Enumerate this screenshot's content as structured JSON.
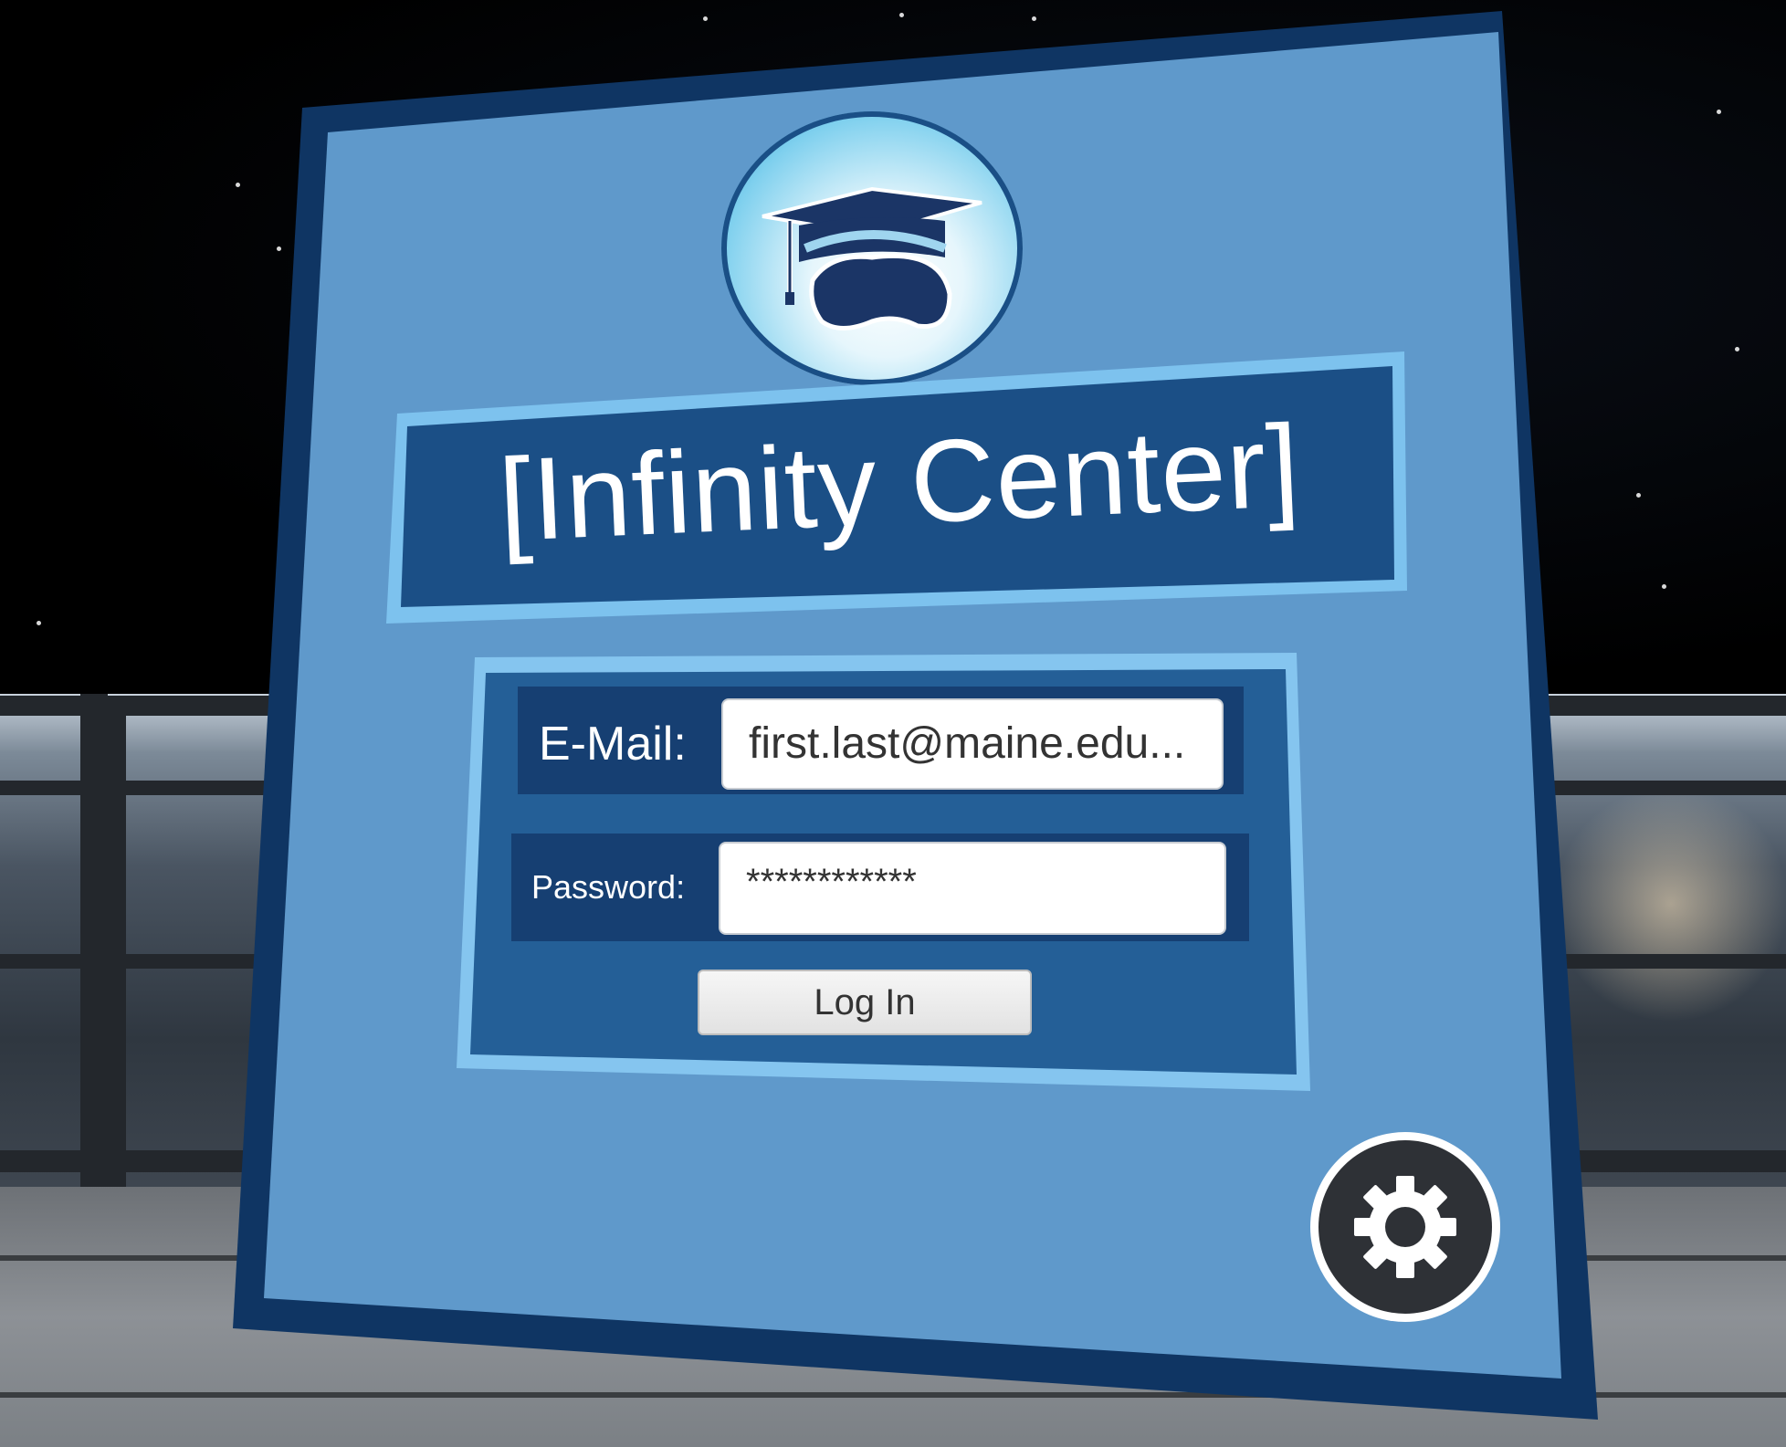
{
  "app": {
    "title": "[Infinity Center]"
  },
  "login_form": {
    "email_label": "E-Mail:",
    "email_value": "first.last@maine.edu...",
    "password_label": "Password:",
    "password_value": "************",
    "login_button_label": "Log In"
  },
  "settings": {
    "icon": "gear-icon"
  },
  "logo": {
    "icon": "graduation-cap-vr-headset-icon"
  },
  "colors": {
    "panel_border": "#0f3563",
    "panel_fill": "#6caadc",
    "title_box": "#1b4f86",
    "title_outline": "#7dc2ee",
    "form_box": "#245f97",
    "field_row": "#163f72",
    "gear_button": "#2e3136"
  }
}
